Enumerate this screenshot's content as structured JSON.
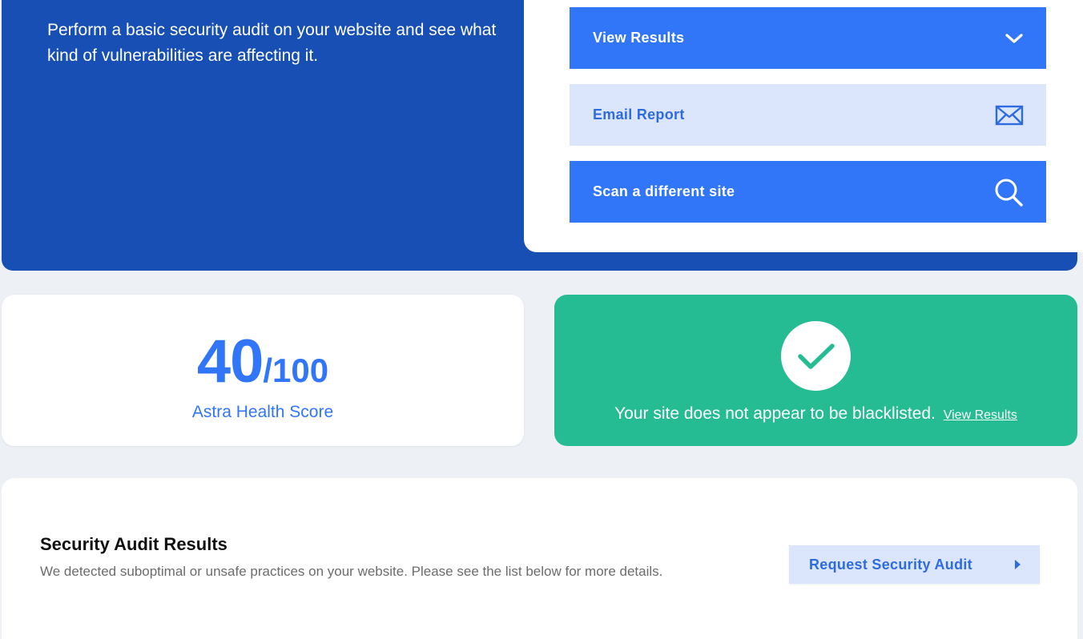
{
  "hero": {
    "description": "Perform a basic security audit on your website and see what kind of vulnerabilities are affecting it."
  },
  "actions": {
    "view_results": {
      "label": "View Results",
      "icon": "chevron-down-icon"
    },
    "email_report": {
      "label": "Email Report",
      "icon": "envelope-icon"
    },
    "scan_site": {
      "label": "Scan a different site",
      "icon": "search-icon"
    }
  },
  "score": {
    "value": "40",
    "total": "/100",
    "label": "Astra Health Score"
  },
  "blacklist": {
    "message": "Your site does not appear to be blacklisted.",
    "link_label": "View Results",
    "icon": "checkmark-icon"
  },
  "audit": {
    "title": "Security Audit Results",
    "description": "We detected suboptimal or unsafe practices on your website. Please see the list below for more details.",
    "request_label": "Request Security Audit"
  },
  "colors": {
    "hero_blue": "#174fb4",
    "primary_blue": "#3176f9",
    "light_blue": "#dbe6fd",
    "success_green": "#25bb93",
    "page_bg": "#edf0f5"
  }
}
